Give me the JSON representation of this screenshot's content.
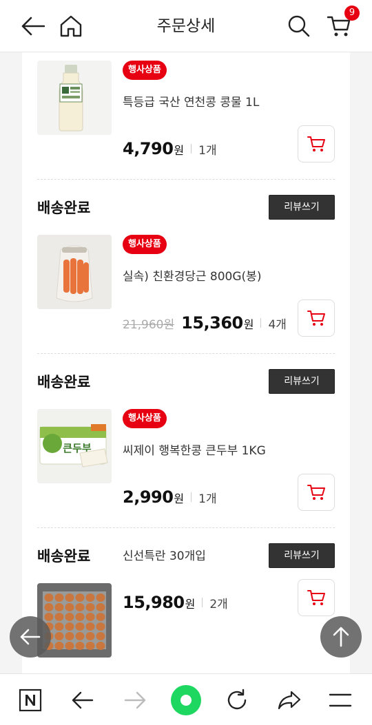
{
  "header": {
    "title": "주문상세",
    "cart_count": "9"
  },
  "items": [
    {
      "status": "",
      "review_label": "",
      "badge": "행사상품",
      "name": "특등급 국산 연천콩 콩물 1L",
      "original_price": "",
      "price": "4,790",
      "won": "원",
      "qty": "1개"
    },
    {
      "status": "배송완료",
      "review_label": "리뷰쓰기",
      "badge": "행사상품",
      "name": "실속) 친환경당근 800G(봉)",
      "original_price": "21,960원",
      "price": "15,360",
      "won": "원",
      "qty": "4개"
    },
    {
      "status": "배송완료",
      "review_label": "리뷰쓰기",
      "badge": "행사상품",
      "name": "씨제이 행복한콩 큰두부 1KG",
      "original_price": "",
      "price": "2,990",
      "won": "원",
      "qty": "1개"
    },
    {
      "status": "배송완료",
      "review_label": "리뷰쓰기",
      "badge": "",
      "name": "신선특란 30개입",
      "original_price": "",
      "price": "15,980",
      "won": "원",
      "qty": "2개"
    }
  ],
  "tofu_box_text": "큰두부",
  "colors": {
    "accent": "#e60012",
    "dark_button": "#333333",
    "browser_green": "#1ed760"
  },
  "icons": [
    "back-arrow-icon",
    "home-icon",
    "search-icon",
    "cart-icon",
    "n-logo-icon",
    "forward-arrow-icon",
    "refresh-icon",
    "share-icon",
    "menu-icon",
    "up-arrow-icon"
  ]
}
